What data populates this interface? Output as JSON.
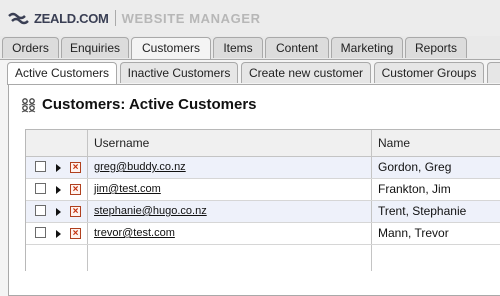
{
  "brand": {
    "name": "ZEALD.COM",
    "app": "WEBSITE MANAGER"
  },
  "main_tabs": [
    {
      "label": "Orders"
    },
    {
      "label": "Enquiries"
    },
    {
      "label": "Customers"
    },
    {
      "label": "Items"
    },
    {
      "label": "Content"
    },
    {
      "label": "Marketing"
    },
    {
      "label": "Reports"
    }
  ],
  "sub_tabs": [
    {
      "label": "Active Customers"
    },
    {
      "label": "Inactive Customers"
    },
    {
      "label": "Create new customer"
    },
    {
      "label": "Customer Groups"
    }
  ],
  "page": {
    "title": "Customers: Active Customers"
  },
  "table": {
    "columns": [
      "Username",
      "Name"
    ],
    "rows": [
      {
        "username": "greg@buddy.co.nz",
        "name": "Gordon, Greg"
      },
      {
        "username": "jim@test.com",
        "name": "Frankton, Jim"
      },
      {
        "username": "stephanie@hugo.co.nz",
        "name": "Trent, Stephanie"
      },
      {
        "username": "trevor@test.com",
        "name": "Mann, Trevor"
      }
    ]
  },
  "icons": {
    "logo": "zeald-logo-icon",
    "title": "users-icon",
    "expand": "expand-arrow-icon",
    "delete": "delete-icon"
  },
  "colors": {
    "accent": "#3a3f54",
    "delete": "#c3300c",
    "row_alt": "#eef1fa"
  }
}
